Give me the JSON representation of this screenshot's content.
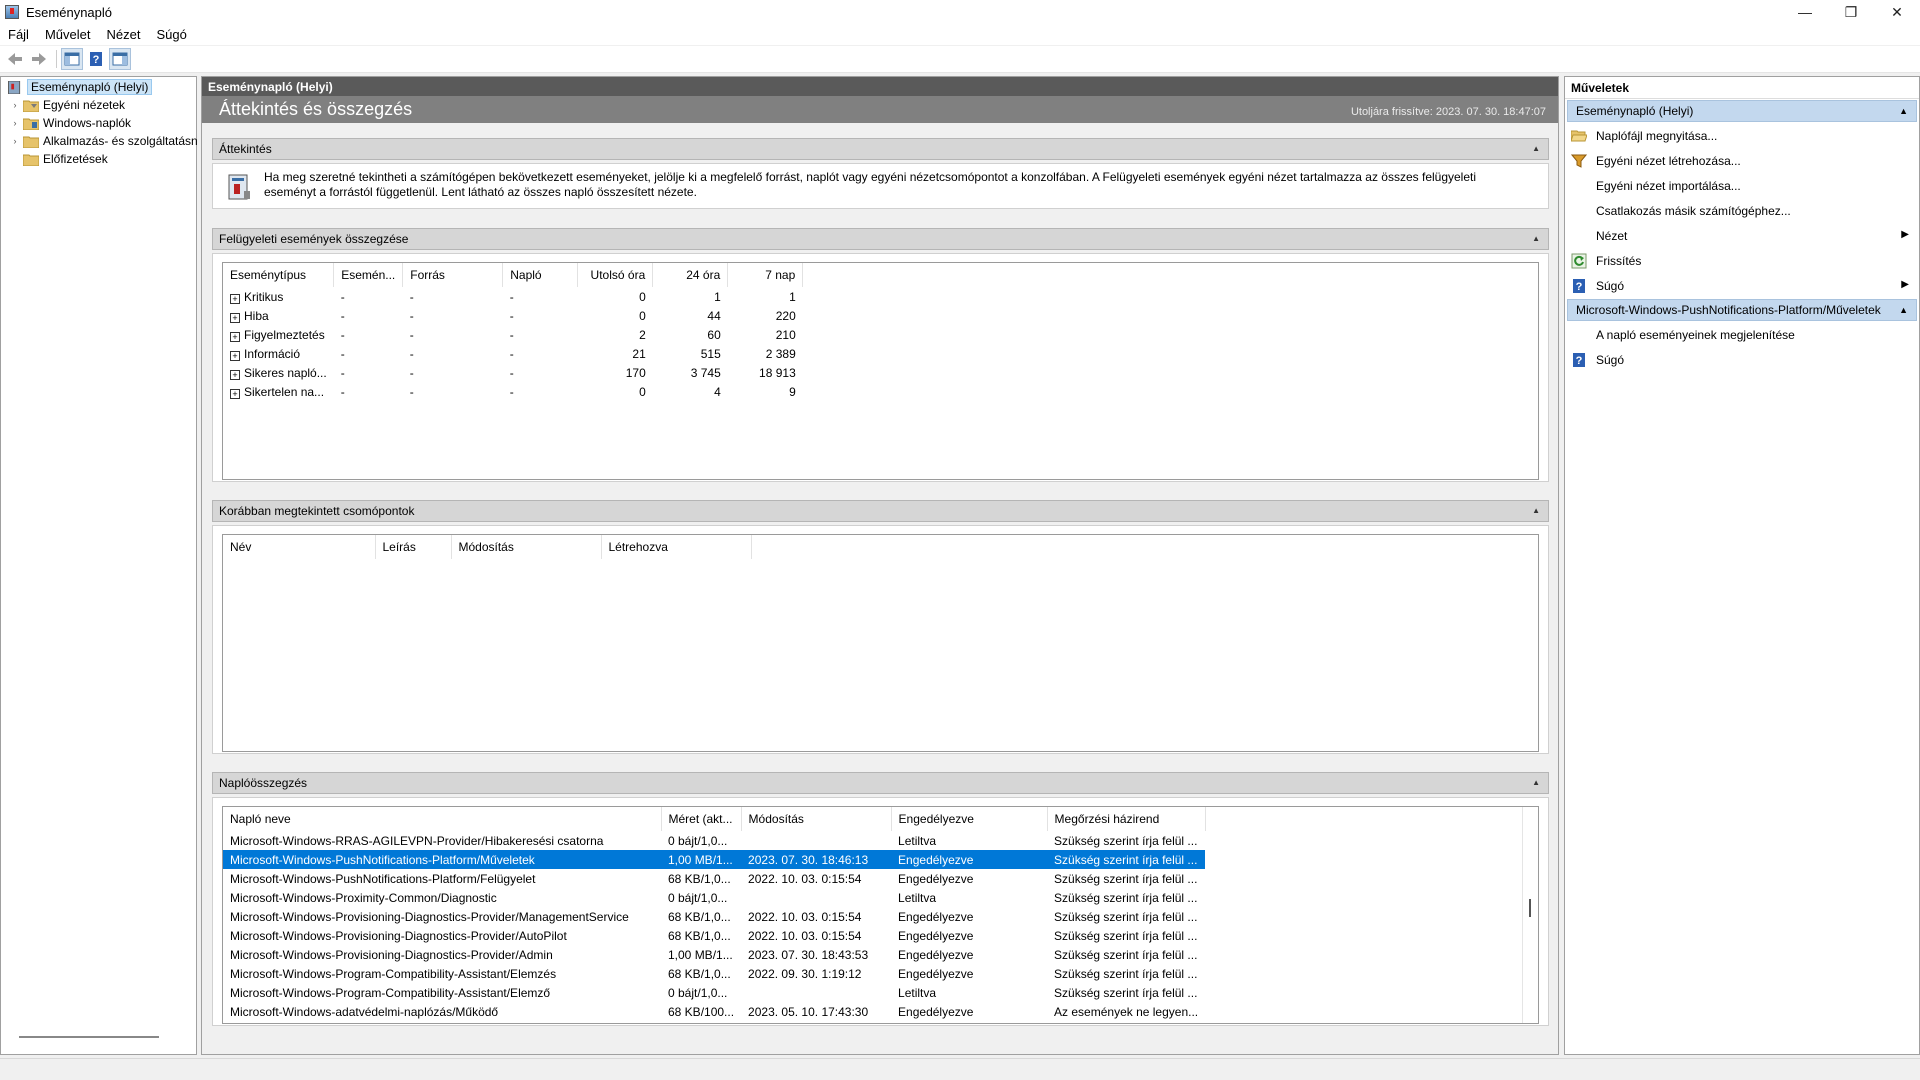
{
  "window": {
    "title": "Eseménynapló",
    "minimize": "—",
    "maximize": "❐",
    "close": "✕"
  },
  "menu": [
    "Fájl",
    "Művelet",
    "Nézet",
    "Súgó"
  ],
  "tree": {
    "items": [
      {
        "label": "Eseménynapló (Helyi)"
      },
      {
        "label": "Egyéni nézetek"
      },
      {
        "label": "Windows-naplók"
      },
      {
        "label": "Alkalmazás- és szolgáltatásn"
      },
      {
        "label": "Előfizetések"
      }
    ]
  },
  "center": {
    "header": "Eseménynapló (Helyi)",
    "title": "Áttekintés és összegzés",
    "refreshed": "Utoljára frissítve: 2023. 07. 30. 18:47:07"
  },
  "overview": {
    "heading": "Áttekintés",
    "text": "Ha meg szeretné tekintheti a számítógépen bekövetkezett eseményeket, jelölje ki a megfelelő forrást, naplót vagy egyéni nézetcsomópontot a konzolfában. A Felügyeleti események egyéni nézet tartalmazza az összes felügyeleti eseményt a forrástól függetlenül. Lent látható az összes napló összesített nézete."
  },
  "summary": {
    "heading": "Felügyeleti események összegzése",
    "columns": [
      "Eseménytípus",
      "Esemén...",
      "Forrás",
      "Napló",
      "Utolsó óra",
      "24 óra",
      "7 nap"
    ],
    "rows": [
      {
        "type": "Kritikus",
        "id": "-",
        "source": "-",
        "log": "-",
        "hour": "0",
        "day": "1",
        "week": "1"
      },
      {
        "type": "Hiba",
        "id": "-",
        "source": "-",
        "log": "-",
        "hour": "0",
        "day": "44",
        "week": "220"
      },
      {
        "type": "Figyelmeztetés",
        "id": "-",
        "source": "-",
        "log": "-",
        "hour": "2",
        "day": "60",
        "week": "210"
      },
      {
        "type": "Információ",
        "id": "-",
        "source": "-",
        "log": "-",
        "hour": "21",
        "day": "515",
        "week": "2 389"
      },
      {
        "type": "Sikeres napló...",
        "id": "-",
        "source": "-",
        "log": "-",
        "hour": "170",
        "day": "3 745",
        "week": "18 913"
      },
      {
        "type": "Sikertelen na...",
        "id": "-",
        "source": "-",
        "log": "-",
        "hour": "0",
        "day": "4",
        "week": "9"
      }
    ]
  },
  "recent": {
    "heading": "Korábban megtekintett csomópontok",
    "columns": [
      "Név",
      "Leírás",
      "Módosítás",
      "Létrehozva"
    ]
  },
  "logsummary": {
    "heading": "Naplóösszegzés",
    "columns": [
      "Napló neve",
      "Méret (akt...",
      "Módosítás",
      "Engedélyezve",
      "Megőrzési házirend"
    ],
    "rows": [
      {
        "name": "Microsoft-Windows-RRAS-AGILEVPN-Provider/Hibakeresési csatorna",
        "size": "0 bájt/1,0...",
        "modified": "",
        "enabled": "Letiltva",
        "policy": "Szükség szerint írja felül ..."
      },
      {
        "name": "Microsoft-Windows-PushNotifications-Platform/Műveletek",
        "size": "1,00 MB/1...",
        "modified": "2023. 07. 30. 18:46:13",
        "enabled": "Engedélyezve",
        "policy": "Szükség szerint írja felül ..."
      },
      {
        "name": "Microsoft-Windows-PushNotifications-Platform/Felügyelet",
        "size": "68 KB/1,0...",
        "modified": "2022. 10. 03. 0:15:54",
        "enabled": "Engedélyezve",
        "policy": "Szükség szerint írja felül ..."
      },
      {
        "name": "Microsoft-Windows-Proximity-Common/Diagnostic",
        "size": "0 bájt/1,0...",
        "modified": "",
        "enabled": "Letiltva",
        "policy": "Szükség szerint írja felül ..."
      },
      {
        "name": "Microsoft-Windows-Provisioning-Diagnostics-Provider/ManagementService",
        "size": "68 KB/1,0...",
        "modified": "2022. 10. 03. 0:15:54",
        "enabled": "Engedélyezve",
        "policy": "Szükség szerint írja felül ..."
      },
      {
        "name": "Microsoft-Windows-Provisioning-Diagnostics-Provider/AutoPilot",
        "size": "68 KB/1,0...",
        "modified": "2022. 10. 03. 0:15:54",
        "enabled": "Engedélyezve",
        "policy": "Szükség szerint írja felül ..."
      },
      {
        "name": "Microsoft-Windows-Provisioning-Diagnostics-Provider/Admin",
        "size": "1,00 MB/1...",
        "modified": "2023. 07. 30. 18:43:53",
        "enabled": "Engedélyezve",
        "policy": "Szükség szerint írja felül ..."
      },
      {
        "name": "Microsoft-Windows-Program-Compatibility-Assistant/Elemzés",
        "size": "68 KB/1,0...",
        "modified": "2022. 09. 30. 1:19:12",
        "enabled": "Engedélyezve",
        "policy": "Szükség szerint írja felül ..."
      },
      {
        "name": "Microsoft-Windows-Program-Compatibility-Assistant/Elemző",
        "size": "0 bájt/1,0...",
        "modified": "",
        "enabled": "Letiltva",
        "policy": "Szükség szerint írja felül ..."
      },
      {
        "name": "Microsoft-Windows-adatvédelmi-naplózás/Működő",
        "size": "68 KB/100...",
        "modified": "2023. 05. 10. 17:43:30",
        "enabled": "Engedélyezve",
        "policy": "Az események ne legyen..."
      }
    ]
  },
  "actions": {
    "title": "Műveletek",
    "group1": "Eseménynapló (Helyi)",
    "items1": [
      {
        "label": "Naplófájl megnyitása...",
        "icon": "open-folder-icon"
      },
      {
        "label": "Egyéni nézet létrehozása...",
        "icon": "filter-icon"
      },
      {
        "label": "Egyéni nézet importálása...",
        "icon": ""
      },
      {
        "label": "Csatlakozás másik számítógéphez...",
        "icon": ""
      },
      {
        "label": "Nézet",
        "icon": "",
        "submenu": true
      },
      {
        "label": "Frissítés",
        "icon": "refresh-icon"
      },
      {
        "label": "Súgó",
        "icon": "help-icon",
        "submenu": true
      }
    ],
    "group2": "Microsoft-Windows-PushNotifications-Platform/Műveletek",
    "items2": [
      {
        "label": "A napló eseményeinek megjelenítése",
        "icon": ""
      },
      {
        "label": "Súgó",
        "icon": "help-icon"
      }
    ]
  },
  "colors": {
    "selection": "#0078d7",
    "header_dark": "#5a5a5a",
    "hero": "#808080",
    "action_group": "#c3d8ee"
  }
}
